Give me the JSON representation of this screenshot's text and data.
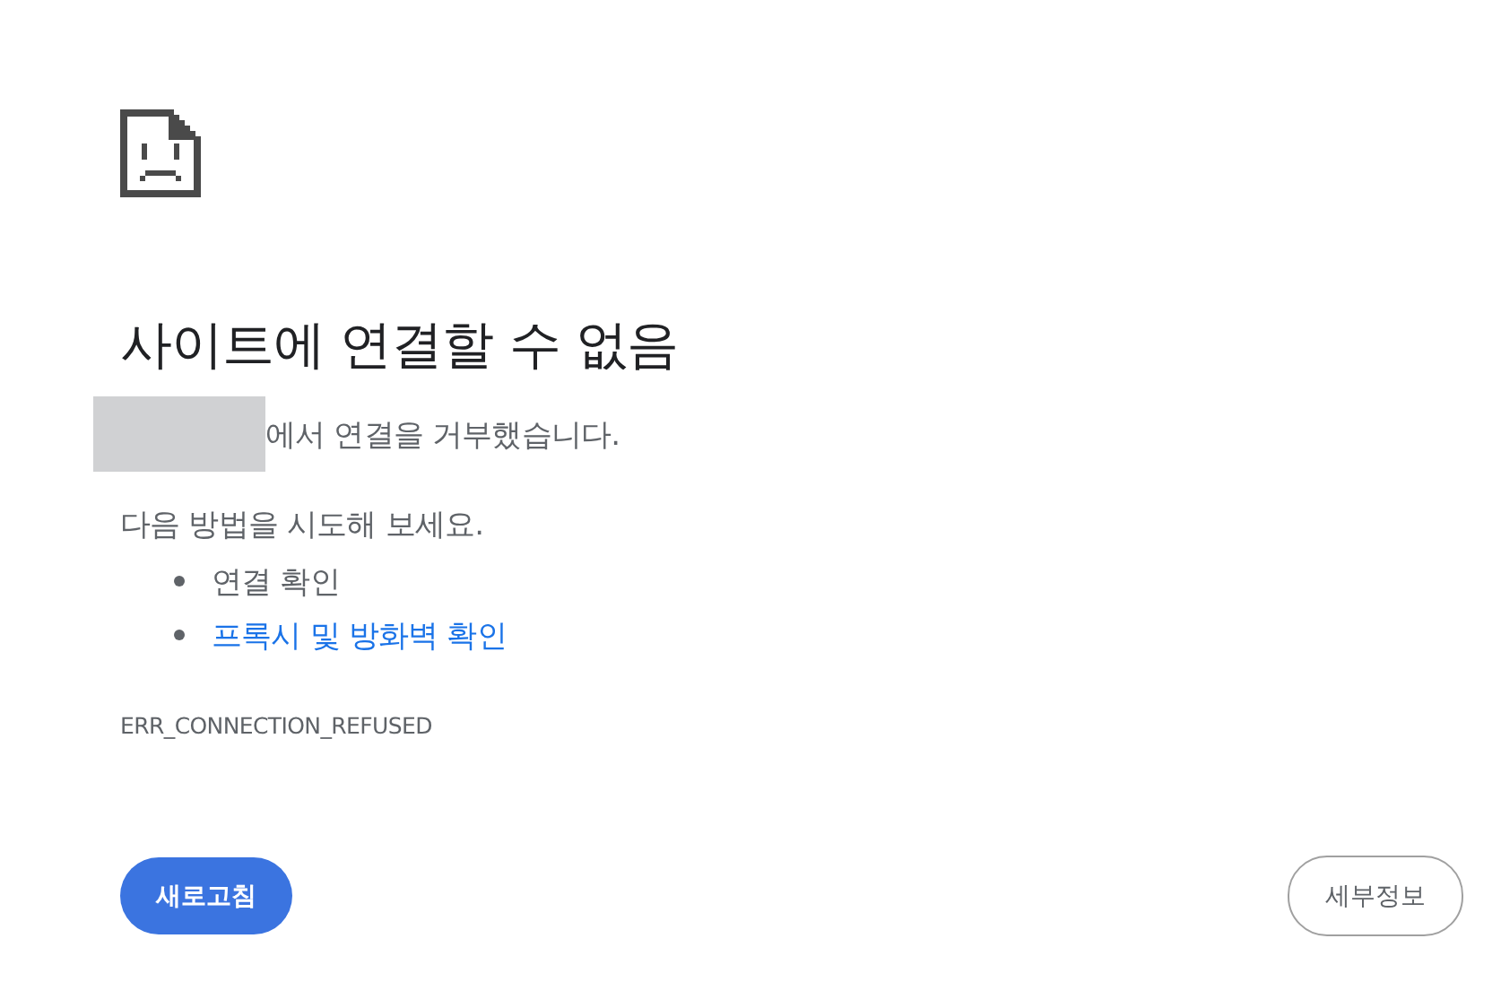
{
  "title": "사이트에 연결할 수 없음",
  "message": {
    "host_redacted": true,
    "text": "에서 연결을 거부했습니다."
  },
  "suggestions_intro": "다음 방법을 시도해 보세요.",
  "suggestions": [
    {
      "kind": "text",
      "label": "연결 확인"
    },
    {
      "kind": "link",
      "label": "프록시 및 방화벽 확인"
    }
  ],
  "error_code": "ERR_CONNECTION_REFUSED",
  "buttons": {
    "reload": "새로고침",
    "details": "세부정보"
  }
}
